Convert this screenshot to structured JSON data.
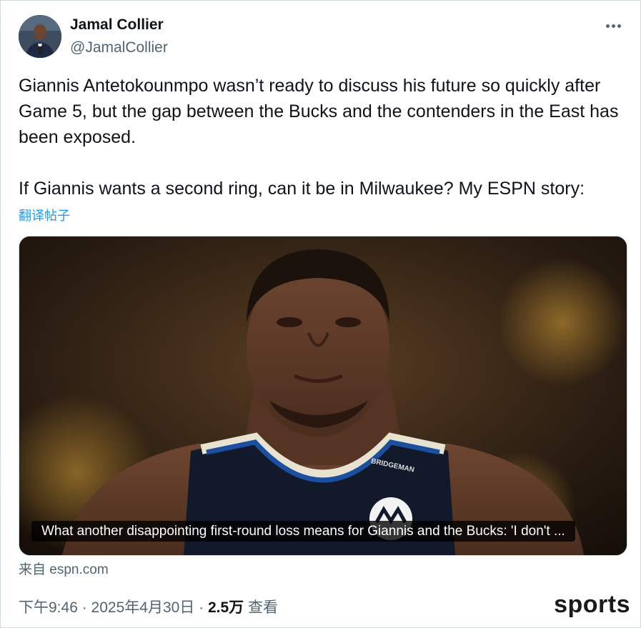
{
  "author": {
    "name": "Jamal Collier",
    "handle": "@JamalCollier"
  },
  "more_icon": "more-horizontal-icon",
  "tweet": {
    "line1": "Giannis Antetokounmpo wasn’t ready to discuss his future so quickly after Game 5, but the gap between the Bucks and the contenders in the East has been exposed.",
    "line2": "If Giannis wants a second ring, can it be in Milwaukee? My ESPN story:",
    "translate_label": "翻译帖子"
  },
  "link_card": {
    "caption": "What another disappointing first-round loss means for Giannis and the Bucks: 'I don't ...",
    "jersey_text": "BRIDGEMAN",
    "source": "来自 espn.com"
  },
  "meta": {
    "time": "下午9:46",
    "sep1": " · ",
    "date": "2025年4月30日",
    "sep2": " · ",
    "views": "2.5万",
    "views_label": " 查看"
  },
  "watermark": "sports"
}
